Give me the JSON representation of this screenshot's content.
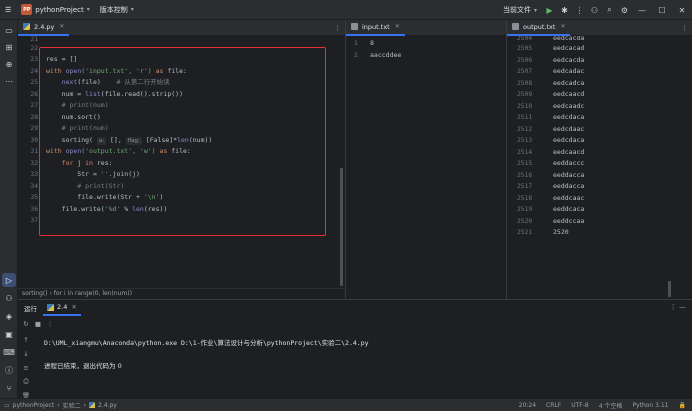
{
  "titlebar": {
    "project_badge": "PP",
    "project_name": "pythonProject",
    "vcs_label": "版本控制",
    "run_config": "当前文件"
  },
  "editor_left": {
    "tab": "2.4.py",
    "line_numbers": [
      "21",
      "22",
      "23",
      "24",
      "25",
      "26",
      "27",
      "28",
      "29",
      "30",
      "31",
      "32",
      "33",
      "34",
      "35",
      "36",
      "37"
    ],
    "code": {
      "l23": "res = []",
      "l24_a": "with ",
      "l24_b": "open",
      "l24_c": "('input.txt', 'r')",
      "l24_d": " as ",
      "l24_e": "file:",
      "l25_a": "    ",
      "l25_b": "next",
      "l25_c": "(file)",
      "l25_d": "    # 从第二行开始读",
      "l26_a": "    num = ",
      "l26_b": "list",
      "l26_c": "(file.read().strip())",
      "l27": "    # print(num)",
      "l28": "    num.sort()",
      "l29": "    # print(num)",
      "l30_a": "    sorting( ",
      "l30_hint1": "a:",
      "l30_b": " [], ",
      "l30_hint2": "flag:",
      "l30_c": " [False]*",
      "l30_d": "len",
      "l30_e": "(num))",
      "l31_a": "with ",
      "l31_b": "open",
      "l31_c": "('output.txt', 'w')",
      "l31_d": " as ",
      "l31_e": "file:",
      "l32_a": "    for ",
      "l32_b": "j",
      "l32_c": " in ",
      "l32_d": "res:",
      "l33_a": "        Str = ",
      "l33_b": "''",
      "l33_c": ".join(j)",
      "l34": "        # print(Str)",
      "l35_a": "        file.write(Str + ",
      "l35_b": "'\\n'",
      "l35_c": ")",
      "l36_a": "    file.write(",
      "l36_b": "'%d'",
      "l36_c": " % ",
      "l36_d": "len",
      "l36_e": "(res))"
    },
    "breadcrumb": "sorting()  ›  for i in range(0, len(num))"
  },
  "editor_mid": {
    "tab": "input.txt",
    "lines": [
      {
        "n": "1",
        "text": "8"
      },
      {
        "n": "2",
        "text": "aaccddee"
      }
    ]
  },
  "editor_right": {
    "tab": "output.txt",
    "lines": [
      {
        "n": "2504",
        "text": "eedcacda"
      },
      {
        "n": "2505",
        "text": "eedcacad"
      },
      {
        "n": "2506",
        "text": "eedcacda"
      },
      {
        "n": "2507",
        "text": "eedcadac"
      },
      {
        "n": "2508",
        "text": "eedcadca"
      },
      {
        "n": "2509",
        "text": "eedcaacd"
      },
      {
        "n": "2510",
        "text": "eedcaadc"
      },
      {
        "n": "2511",
        "text": "eedcdaca"
      },
      {
        "n": "2512",
        "text": "eedcdaac"
      },
      {
        "n": "2513",
        "text": "eedcdaca"
      },
      {
        "n": "2514",
        "text": "eedcaacd"
      },
      {
        "n": "2515",
        "text": "eeddaccc"
      },
      {
        "n": "2516",
        "text": "eeddacca"
      },
      {
        "n": "2517",
        "text": "eeddacca"
      },
      {
        "n": "2518",
        "text": "eeddcaac"
      },
      {
        "n": "2519",
        "text": "eeddcaca"
      },
      {
        "n": "2520",
        "text": "eeddccaa"
      },
      {
        "n": "2521",
        "text": "2520"
      }
    ]
  },
  "run_panel": {
    "title": "运行",
    "tab": "2.4",
    "command": "D:\\UML_xiangmu\\Anaconda\\python.exe D:\\1-作业\\算法设计与分析\\pythonProject\\实验二\\2.4.py",
    "exit_message": "进程已结束，退出代码为 0"
  },
  "statusbar": {
    "crumb_project": "pythonProject",
    "crumb_folder": "实验二",
    "crumb_file": "2.4.py",
    "position": "20:24",
    "line_sep": "CRLF",
    "encoding": "UTF-8",
    "indent": "4 个空格",
    "interpreter": "Python 3.11"
  }
}
